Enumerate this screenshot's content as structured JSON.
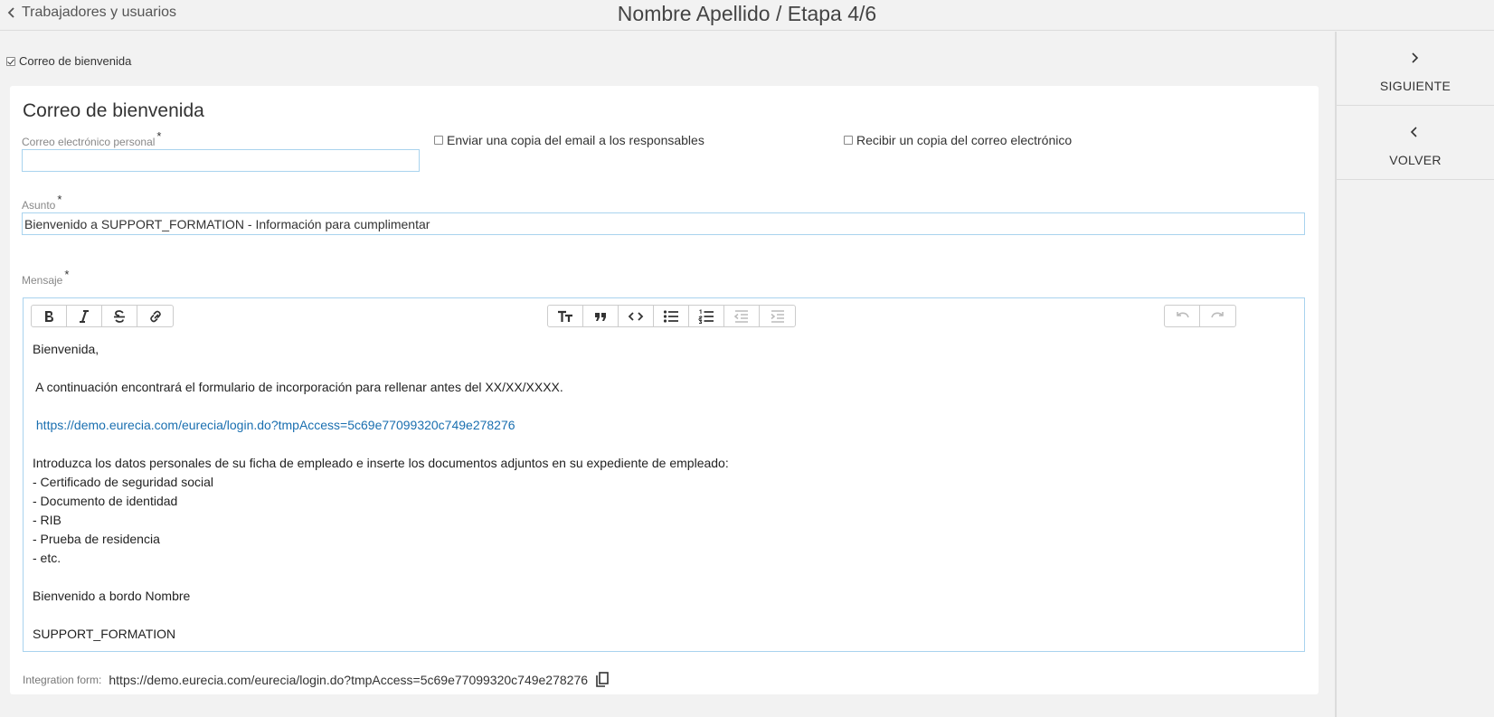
{
  "header": {
    "back_label": "Trabajadores y usuarios",
    "title": "Nombre Apellido / Etapa 4/6"
  },
  "main": {
    "top_checkbox_label": "Correo de bienvenida",
    "card": {
      "title": "Correo de bienvenida",
      "email_label": "Correo electrónico personal",
      "email_value": "",
      "copy_to_managers_label": "Enviar una copia del email a los responsables",
      "receive_copy_label": "Recibir un copia del correo electrónico",
      "subject_label": "Asunto",
      "subject_value": "Bienvenido a SUPPORT_FORMATION - Información para cumplimentar",
      "message_label": "Mensaje",
      "required_mark": "*",
      "message": {
        "line1": "Bienvenida,",
        "line2": " A continuación encontrará el formulario de incorporación para rellenar antes del XX/XX/XXXX.",
        "link": "https://demo.eurecia.com/eurecia/login.do?tmpAccess=5c69e77099320c749e278276",
        "line4": "Introduzca los datos personales de su ficha de empleado e inserte los documentos adjuntos en su expediente de empleado:",
        "bullets": [
          "- Certificado de seguridad social",
          "- Documento de identidad",
          "- RIB",
          "- Prueba de residencia",
          "- etc."
        ],
        "line6": "Bienvenido a bordo Nombre",
        "line7": "SUPPORT_FORMATION"
      },
      "integration_label": "Integration form:",
      "integration_url": "https://demo.eurecia.com/eurecia/login.do?tmpAccess=5c69e77099320c749e278276"
    }
  },
  "side": {
    "next_label": "SIGUIENTE",
    "back_label": "VOLVER"
  },
  "colors": {
    "input_border": "#a9d3ee",
    "link": "#1a6fb0",
    "background": "#f2f2f2"
  }
}
